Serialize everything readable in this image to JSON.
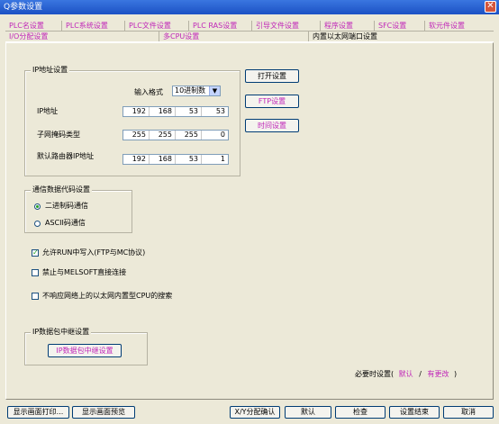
{
  "window": {
    "title": "Q参数设置",
    "close_glyph": "✕"
  },
  "tabs_row1": [
    "PLC名设置",
    "PLC系统设置",
    "PLC文件设置",
    "PLC RAS设置",
    "引导文件设置",
    "程序设置",
    "SFC设置",
    "软元件设置"
  ],
  "tabs_row2": [
    "I/O分配设置",
    "多CPU设置",
    "内置以太网端口设置"
  ],
  "ip_group": {
    "legend": "IP地址设置",
    "input_format_label": "输入格式",
    "input_format_value": "10进制数",
    "ip_label": "IP地址",
    "ip": [
      "192",
      "168",
      "53",
      "53"
    ],
    "subnet_label": "子网掩码类型",
    "subnet": [
      "255",
      "255",
      "255",
      "0"
    ],
    "gateway_label": "默认路由器IP地址",
    "gateway": [
      "192",
      "168",
      "53",
      "1"
    ]
  },
  "side_buttons": {
    "open": "打开设置",
    "ftp": "FTP设置",
    "time": "时间设置"
  },
  "comm_group": {
    "legend": "通信数据代码设置",
    "binary": "二进制码通信",
    "ascii": "ASCII码通信",
    "selected": "binary"
  },
  "checkboxes": {
    "run_write": {
      "label": "允许RUN中写入(FTP与MC协议)",
      "checked": true
    },
    "melsoft": {
      "label": "禁止与MELSOFT直接连接",
      "checked": false
    },
    "no_search": {
      "label": "不响应网络上的以太网内置型CPU的搜索",
      "checked": false
    }
  },
  "relay_group": {
    "legend": "IP数据包中继设置",
    "button": "IP数据包中继设置"
  },
  "required": {
    "prefix": "必要时设置(",
    "default": "默认",
    "sep": "/",
    "changed": "有更改",
    "suffix": ")"
  },
  "footer": {
    "print": "显示画面打印...",
    "preview": "显示画面预览",
    "xy": "X/Y分配确认",
    "default": "默认",
    "check": "检查",
    "end": "设置结束",
    "cancel": "取消"
  },
  "colors": {
    "accent_pink": "#c026b8",
    "titlebar": "#1b51c4",
    "dialog_bg": "#ece9d8"
  }
}
